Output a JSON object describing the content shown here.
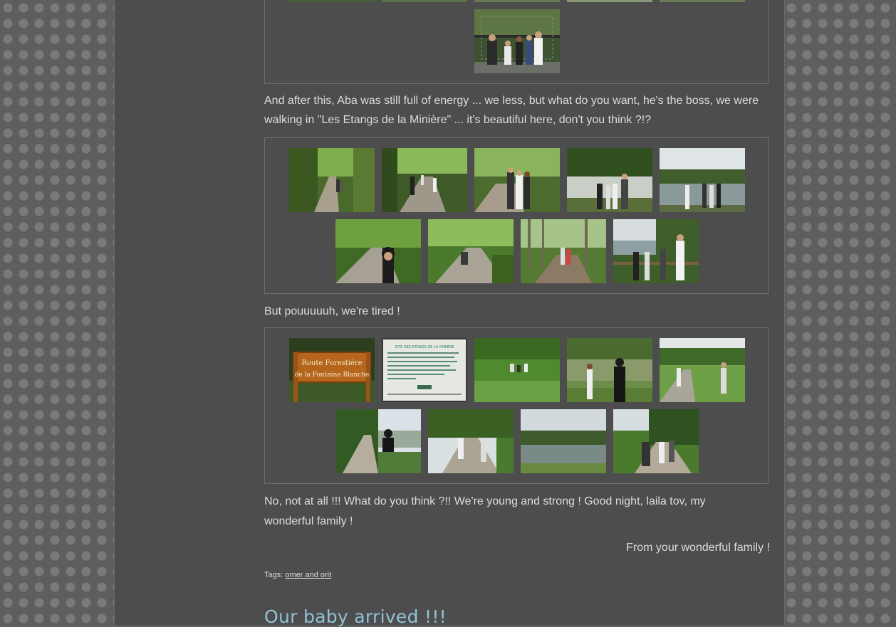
{
  "paragraphs": {
    "p1": "And after this, Aba was still full of energy ... we less, but what do you want, he's the boss, we were walking in \"Les Etangs de la Minière\" ... it's beautiful here, don't you think ?!?",
    "p2": "But pouuuuuh, we're tired !",
    "p3": "No, not at all !!! What do you think ?!! We're young and strong ! Good night, laila tov, my wonderful family !",
    "p4": "From your wonderful family !"
  },
  "tags": {
    "label": "Tags:",
    "link": "omer and orit"
  },
  "next_post": {
    "title": "Our baby arrived !!!"
  },
  "sign_1": {
    "line1": "Route Forestière",
    "line2": "de la Fontaine Blanche"
  },
  "sign_2": {
    "title": "SITE DES ETANGS DE LA MINIÈRE"
  },
  "colors": {
    "page_bg": "#5e5e5e",
    "content_bg": "#4d4d4d",
    "text": "#dcdcdc",
    "title": "#8fc3d6"
  }
}
